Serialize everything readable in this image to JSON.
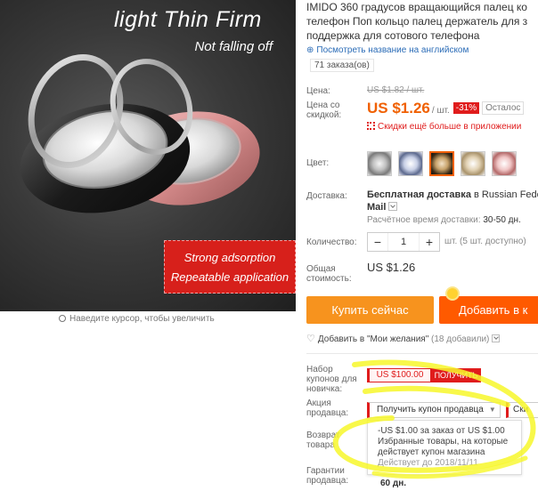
{
  "hero": {
    "title": "light Thin Firm",
    "subtitle": "Not falling off",
    "badge_line1": "Strong adsorption",
    "badge_line2": "Repeatable application",
    "zoom_hint": "Наведите курсор, чтобы увеличить"
  },
  "product": {
    "title": "IMIDO 360 градусов вращающийся палец ко телефон Поп кольцо палец держатель для з поддержка для сотового телефона",
    "translate_link": "Посмотреть название на английском",
    "orders": "71 заказа(ов)"
  },
  "pricing": {
    "price_label": "Цена:",
    "old_price": "US $1.82 / шт.",
    "discount_label": "Цена со скидкой:",
    "price": "US $1.26",
    "unit": "/ шт.",
    "discount_badge": "-31%",
    "remaining": "Осталос",
    "app_discount": "Скидки ещё больше в приложении",
    "accent_color": "#f06000"
  },
  "color": {
    "label": "Цвет:",
    "selected_index": 2
  },
  "shipping": {
    "label": "Доставка:",
    "title_bold": "Бесплатная доставка",
    "title_rest": " в Russian Federa",
    "method": "Mail",
    "estimate_label": "Расчётное время доставки:",
    "estimate_value": "30-50 дн."
  },
  "quantity": {
    "label": "Количество:",
    "minus": "−",
    "value": "1",
    "plus": "+",
    "note": "шт. (5 шт. доступно)"
  },
  "total": {
    "label": "Общая стоимость:",
    "value": "US $1.26"
  },
  "actions": {
    "buy_now": "Купить сейчас",
    "add_to_cart": "Добавить в к",
    "wishlist": "Добавить в \"Мои желания\"",
    "wishlist_count": "(18 добавили)"
  },
  "coupons": {
    "newbie_label": "Набор купонов для новичка:",
    "newbie_value": "US $100.00",
    "get_button": "ПОЛУЧИТЬ",
    "seller_promo_label": "Акция продавца:",
    "seller_select": "Получить купон продавца",
    "seller_select2": "Ски",
    "popup_line1": "-US $1.00 за заказ от US $1.00",
    "popup_line2": "Избранные товары, на которые",
    "popup_line3": "действует купон магазина",
    "popup_expiry": "Действует до 2018/11/11",
    "return_label": "Возврат товара",
    "guarantee_label": "Гарантии продавца:",
    "guarantee_value": "60 дн."
  }
}
